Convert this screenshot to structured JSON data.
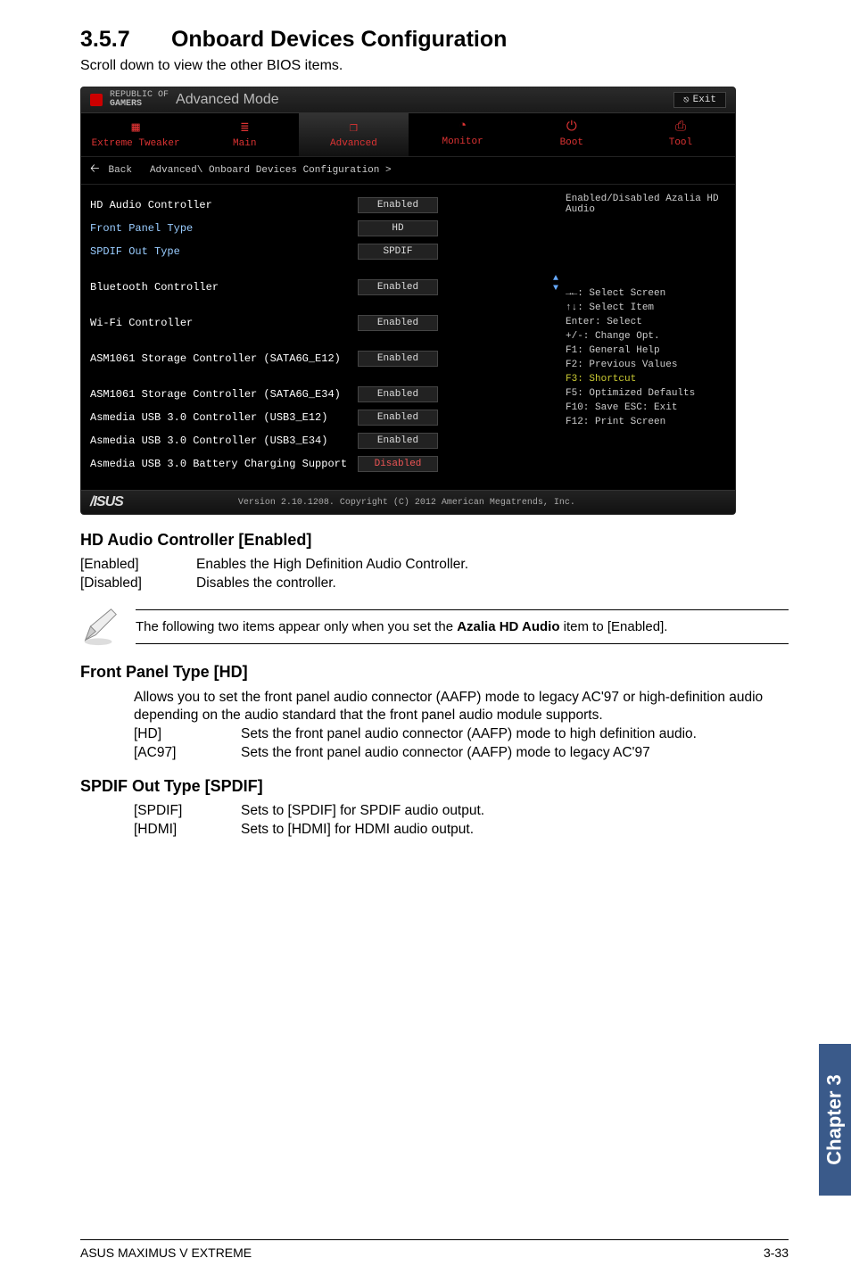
{
  "section": {
    "num": "3.5.7",
    "title": "Onboard Devices Configuration",
    "sub": "Scroll down to view the other BIOS items."
  },
  "bios": {
    "brand_top": "REPUBLIC OF",
    "brand_bot": "GAMERS",
    "mode": "Advanced Mode",
    "exit_label": "Exit",
    "tabs": [
      "Extreme Tweaker",
      "Main",
      "Advanced",
      "Monitor",
      "Boot",
      "Tool"
    ],
    "back": "Back",
    "crumb": "Advanced\\ Onboard Devices Configuration >",
    "rows": [
      {
        "label": "HD Audio Controller",
        "value": "Enabled",
        "cyan": false
      },
      {
        "label": "Front Panel Type",
        "value": "HD",
        "cyan": true
      },
      {
        "label": "SPDIF Out Type",
        "value": "SPDIF",
        "cyan": true,
        "gapAfter": true
      },
      {
        "label": "Bluetooth Controller",
        "value": "Enabled",
        "cyan": false,
        "gapAfter": true
      },
      {
        "label": "Wi-Fi Controller",
        "value": "Enabled",
        "cyan": false,
        "gapAfter": true
      },
      {
        "label": "ASM1061 Storage Controller (SATA6G_E12)",
        "value": "Enabled",
        "cyan": false,
        "gapAfter": true
      },
      {
        "label": "ASM1061 Storage Controller (SATA6G_E34)",
        "value": "Enabled",
        "cyan": false,
        "gapAfter": false
      },
      {
        "label": "Asmedia USB 3.0 Controller (USB3_E12)",
        "value": "Enabled",
        "cyan": false
      },
      {
        "label": "Asmedia USB 3.0 Controller (USB3_E34)",
        "value": "Enabled",
        "cyan": false
      },
      {
        "label": "Asmedia USB 3.0 Battery Charging Support",
        "value": "Disabled",
        "cyan": false,
        "red": true
      }
    ],
    "help_top": "Enabled/Disabled Azalia HD Audio",
    "help_keys": [
      "→←: Select Screen",
      "↑↓: Select Item",
      "Enter: Select",
      "+/-: Change Opt.",
      "F1: General Help",
      "F2: Previous Values",
      "F3: Shortcut",
      "F5: Optimized Defaults",
      "F10: Save   ESC: Exit",
      "F12: Print Screen"
    ],
    "help_highlight_idx": 6,
    "footer_version": "Version 2.10.1208. Copyright (C) 2012 American Megatrends, Inc.",
    "footer_brand": "/ISUS"
  },
  "hd_audio": {
    "heading": "HD Audio Controller [Enabled]",
    "rows": [
      {
        "k": "[Enabled]",
        "v": "Enables the High Definition Audio Controller."
      },
      {
        "k": "[Disabled]",
        "v": "Disables the controller."
      }
    ]
  },
  "note": {
    "text_pre": "The following two items appear only when you set the ",
    "bold": "Azalia HD Audio",
    "text_post": " item to [Enabled]."
  },
  "front_panel": {
    "heading": "Front Panel Type [HD]",
    "desc": "Allows you to set the front panel audio connector (AAFP) mode to legacy AC'97 or high-definition audio depending on the audio standard that the front panel audio module supports.",
    "rows": [
      {
        "k": "[HD]",
        "v": "Sets the front panel audio connector (AAFP) mode to high definition audio."
      },
      {
        "k": "[AC97]",
        "v": "Sets the front panel audio connector (AAFP) mode to legacy AC'97"
      }
    ]
  },
  "spdif": {
    "heading": "SPDIF Out Type [SPDIF]",
    "rows": [
      {
        "k": "[SPDIF]",
        "v": "Sets to [SPDIF] for SPDIF audio output."
      },
      {
        "k": "[HDMI]",
        "v": "Sets to [HDMI] for HDMI audio output."
      }
    ]
  },
  "sidebar": "Chapter 3",
  "footer": {
    "left": "ASUS MAXIMUS V EXTREME",
    "right": "3-33"
  },
  "icons": {
    "tabs": [
      "chip-icon",
      "list-icon",
      "overlap-icon",
      "gauge-icon",
      "power-icon",
      "printer-icon"
    ]
  }
}
